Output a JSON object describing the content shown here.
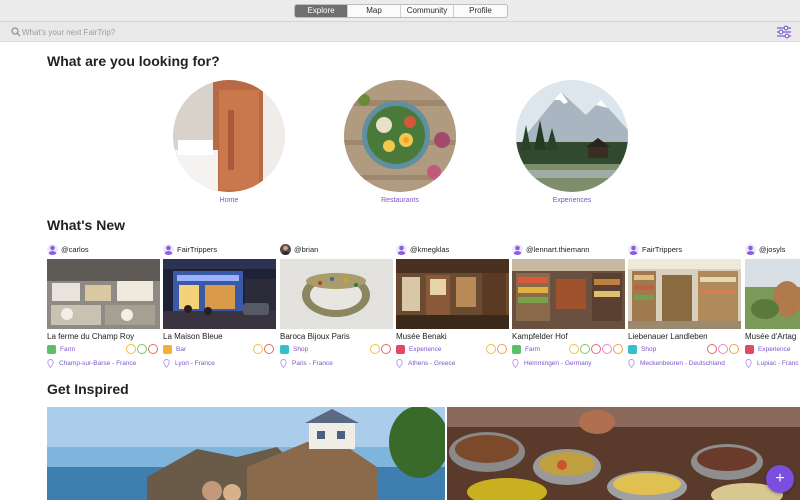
{
  "nav": {
    "tabs": [
      {
        "label": "Explore",
        "active": true
      },
      {
        "label": "Map",
        "active": false
      },
      {
        "label": "Community",
        "active": false
      },
      {
        "label": "Profile",
        "active": false
      }
    ]
  },
  "search": {
    "placeholder": "What's your next FairTrip?",
    "icon": "search-icon",
    "filter_icon": "sliders-icon"
  },
  "categories_section": {
    "title": "What are you looking for?",
    "items": [
      {
        "label": "Home"
      },
      {
        "label": "Restaurants"
      },
      {
        "label": "Experiences"
      }
    ]
  },
  "whats_new": {
    "title": "What's New",
    "cards": [
      {
        "user": "@carlos",
        "name": "La ferme du Champ Roy",
        "type": "Farm",
        "location": "Champ-sur-Barse - France"
      },
      {
        "user": "FairTrippers",
        "name": "La Maison Bleue",
        "type": "Bar",
        "location": "Lyon - France"
      },
      {
        "user": "@brian",
        "name": "Baroca Bijoux Paris",
        "type": "Shop",
        "location": "Paris - France"
      },
      {
        "user": "@kmegklas",
        "name": "Musée Benaki",
        "type": "Experience",
        "location": "Athens - Greece"
      },
      {
        "user": "@lennart.thiemann",
        "name": "Kampfelder Hof",
        "type": "Farm",
        "location": "Hemmingen - Germany"
      },
      {
        "user": "FairTrippers",
        "name": "Liebenauer Landleben",
        "type": "Shop",
        "location": "Meckenbeuren - Deutschland"
      },
      {
        "user": "@josyls",
        "name": "Musée d'Artag",
        "type": "Experience",
        "location": "Lupiac - Franc"
      }
    ]
  },
  "inspired": {
    "title": "Get Inspired"
  },
  "fab": {
    "label": "+"
  },
  "colors": {
    "accent": "#7b55c9",
    "fab": "#7a4fe0",
    "farm_badge": "#5cbf6a",
    "bar_badge": "#f2b233",
    "shop_badge": "#35c0c9",
    "experience_badge": "#e2486a"
  }
}
